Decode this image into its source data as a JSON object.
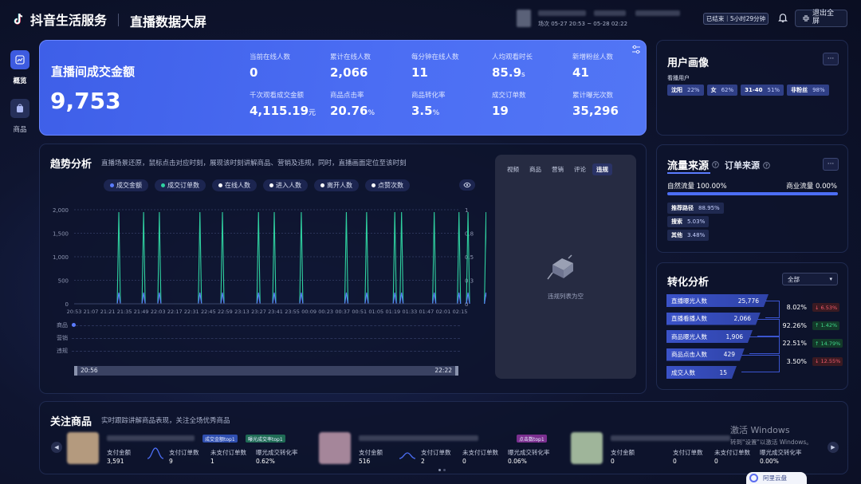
{
  "app": {
    "logo": "抖音生活服务",
    "title": "直播数据大屏"
  },
  "session": {
    "time": "场次 05-27 20:53 ~ 05-28 02:22",
    "status": "已结束｜5小时29分钟",
    "exit_label": "退出全屏"
  },
  "sidebar": {
    "items": [
      {
        "label": "概览",
        "icon": "chart-icon"
      },
      {
        "label": "商品",
        "icon": "bag-icon"
      }
    ]
  },
  "hero": {
    "title": "直播间成交金额",
    "value": "9,753",
    "metrics": [
      {
        "label": "当前在线人数",
        "value": "0",
        "unit": ""
      },
      {
        "label": "累计在线人数",
        "value": "2,066",
        "unit": ""
      },
      {
        "label": "每分钟在线人数",
        "value": "11",
        "unit": ""
      },
      {
        "label": "人均观看时长",
        "value": "85.9",
        "unit": "s"
      },
      {
        "label": "新增粉丝人数",
        "value": "41",
        "unit": ""
      },
      {
        "label": "千次观看成交金额",
        "value": "4,115.19",
        "unit": "元"
      },
      {
        "label": "商品点击率",
        "value": "20.76",
        "unit": "%"
      },
      {
        "label": "商品转化率",
        "value": "3.5",
        "unit": "%"
      },
      {
        "label": "成交订单数",
        "value": "19",
        "unit": ""
      },
      {
        "label": "累计曝光次数",
        "value": "35,296",
        "unit": ""
      }
    ]
  },
  "trend": {
    "title": "趋势分析",
    "desc": "直播场景还原，鼠标点击对应时刻，展现该时刻讲解商品、营销及违规，同时，直播画面定位至该时刻",
    "chips": [
      {
        "label": "成交金额",
        "color": "#5b7cff"
      },
      {
        "label": "成交订单数",
        "color": "#2fd1a0"
      },
      {
        "label": "在线人数",
        "color": "#ffffff"
      },
      {
        "label": "进入人数",
        "color": "#ffffff"
      },
      {
        "label": "离开人数",
        "color": "#ffffff"
      },
      {
        "label": "点赞次数",
        "color": "#ffffff"
      }
    ],
    "row_labels": [
      "商品",
      "营销",
      "违规"
    ],
    "range_start": "20:56",
    "range_end": "22:22"
  },
  "chart_data": {
    "type": "line",
    "x": [
      "20:53",
      "21:07",
      "21:21",
      "21:35",
      "21:49",
      "22:03",
      "22:17",
      "22:31",
      "22:45",
      "22:59",
      "23:13",
      "23:27",
      "23:41",
      "23:55",
      "00:09",
      "00:23",
      "00:37",
      "00:51",
      "01:05",
      "01:19",
      "01:33",
      "01:47",
      "02:01",
      "02:15"
    ],
    "y_left_ticks": [
      "2,000",
      "1,500",
      "1,000",
      "500",
      "0"
    ],
    "y_right_ticks": [
      "1",
      "0.8",
      "0.5",
      "0.3",
      "0"
    ],
    "ylim_left": [
      0,
      2000
    ],
    "ylim_right": [
      0,
      1
    ],
    "spikes_minutes": [
      34,
      56,
      70,
      106,
      126,
      158,
      172,
      196,
      236,
      254,
      279,
      285,
      314,
      336,
      344,
      360,
      374,
      412,
      440,
      468
    ],
    "spike_values": [
      1950,
      1950,
      1950,
      1950,
      1950,
      1950,
      1950,
      1950,
      1950,
      1950,
      1950,
      1950,
      1950,
      1950,
      1950,
      1950,
      1950,
      1950,
      1950,
      1950
    ],
    "spike_left_offset": [
      1,
      0,
      1,
      0,
      1,
      1,
      0,
      1,
      0,
      1,
      1,
      0,
      1,
      0,
      1,
      1,
      0,
      1,
      0,
      1
    ],
    "grid": true
  },
  "video": {
    "tabs": [
      "视频",
      "商品",
      "营销",
      "评论",
      "违规"
    ],
    "active_tab": "违规",
    "empty_text": "违规列表为空"
  },
  "user_portrait": {
    "title": "用户画像",
    "subtitle": "看播用户",
    "tags": [
      {
        "k": "沈阳",
        "v": "22%"
      },
      {
        "k": "女",
        "v": "62%"
      },
      {
        "k": "31-40",
        "v": "51%"
      },
      {
        "k": "非粉丝",
        "v": "98%"
      }
    ]
  },
  "traffic": {
    "tab_active": "流量来源",
    "tab_other": "订单来源",
    "natural_label": "自然流量 100.00%",
    "paid_label": "商业流量 0.00%",
    "natural_fraction": 1.0,
    "items": [
      {
        "k": "推荐路径",
        "v": "88.95%"
      },
      {
        "k": "搜索",
        "v": "5.03%"
      },
      {
        "k": "其他",
        "v": "3.48%"
      }
    ]
  },
  "conversion": {
    "title": "转化分析",
    "select": "全部",
    "steps": [
      {
        "label": "直播曝光人数",
        "value": "25,776"
      },
      {
        "label": "直播看播人数",
        "value": "2,066"
      },
      {
        "label": "商品曝光人数",
        "value": "1,906"
      },
      {
        "label": "商品点击人数",
        "value": "429"
      },
      {
        "label": "成交人数",
        "value": "15"
      }
    ],
    "rates": [
      {
        "rate": "8.02%",
        "delta": "↓ 6.53%",
        "dir": "down"
      },
      {
        "rate": "92.26%",
        "delta": "↑ 1.42%",
        "dir": "up"
      },
      {
        "rate": "22.51%",
        "delta": "↑ 14.79%",
        "dir": "up"
      },
      {
        "rate": "3.50%",
        "delta": "↓ 12.55%",
        "dir": "down"
      }
    ]
  },
  "products": {
    "title": "关注商品",
    "desc": "实时跟踪讲解商品表现，关注全场优秀商品",
    "items": [
      {
        "tags": [
          {
            "t": "成交金额top1",
            "c": "#2f4fb0"
          },
          {
            "t": "曝光成交率top1",
            "c": "#1f6b55"
          }
        ],
        "f": [
          {
            "l": "支付金额",
            "v": "3,591"
          },
          {
            "l": "支付订单数",
            "v": "9"
          },
          {
            "l": "未支付订单数",
            "v": "1"
          },
          {
            "l": "曝光成交转化率",
            "v": "0.62%"
          }
        ]
      },
      {
        "tags": [
          {
            "t": "点击数top1",
            "c": "#7b2f8f"
          }
        ],
        "f": [
          {
            "l": "支付金额",
            "v": "516"
          },
          {
            "l": "支付订单数",
            "v": "2"
          },
          {
            "l": "未支付订单数",
            "v": "0"
          },
          {
            "l": "曝光成交转化率",
            "v": "0.06%"
          }
        ]
      },
      {
        "tags": [],
        "f": [
          {
            "l": "支付金额",
            "v": "0"
          },
          {
            "l": "支付订单数",
            "v": "0"
          },
          {
            "l": "未支付订单数",
            "v": "0"
          },
          {
            "l": "曝光成交转化率",
            "v": "0.00%"
          }
        ]
      }
    ]
  },
  "watermark": {
    "line1": "激活 Windows",
    "line2": "转到\"设置\"以激活 Windows。",
    "cloud": "阿里云盘"
  }
}
